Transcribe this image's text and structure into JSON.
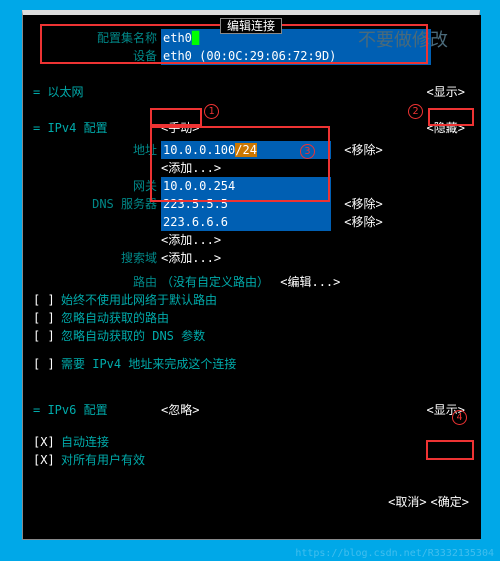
{
  "title": "编辑连接",
  "watermark_text": "不要做修改",
  "topbox": {
    "profile_label": "配置集名称",
    "profile_value": "eth0",
    "device_label": "设备",
    "device_value": "eth0 (00:0C:29:06:72:9D)"
  },
  "ethernet_label": "= 以太网",
  "show_label": "<显示>",
  "ipv4": {
    "heading": "= IPv4 配置",
    "mode": "<手动>",
    "hide_label": "<隐藏>",
    "address_label": "地址",
    "address_value": "10.0.0.100",
    "address_mask": "/24",
    "remove": "<移除>",
    "add": "<添加...>",
    "gateway_label": "网关",
    "gateway_value": "10.0.0.254",
    "dns_label": "DNS 服务器",
    "dns1": "223.5.5.5",
    "dns2": "223.6.6.6",
    "search_label": "搜索域",
    "route_label": "路由",
    "route_note": "（没有自定义路由）",
    "edit": "<编辑...>",
    "cb1": "始终不使用此网络于默认路由",
    "cb2": "忽略自动获取的路由",
    "cb3": "忽略自动获取的 DNS 参数",
    "cb4": "需要 IPv4 地址来完成这个连接"
  },
  "ipv6": {
    "heading": "= IPv6 配置",
    "mode": "<忽略>"
  },
  "auto_connect": "自动连接",
  "all_users": "对所有用户有效",
  "cancel": "<取消>",
  "ok": "<确定>",
  "circles": {
    "c1": "1",
    "c2": "2",
    "c3": "3",
    "c4": "4"
  },
  "footer_wm": "https://blog.csdn.net/R3332135304"
}
